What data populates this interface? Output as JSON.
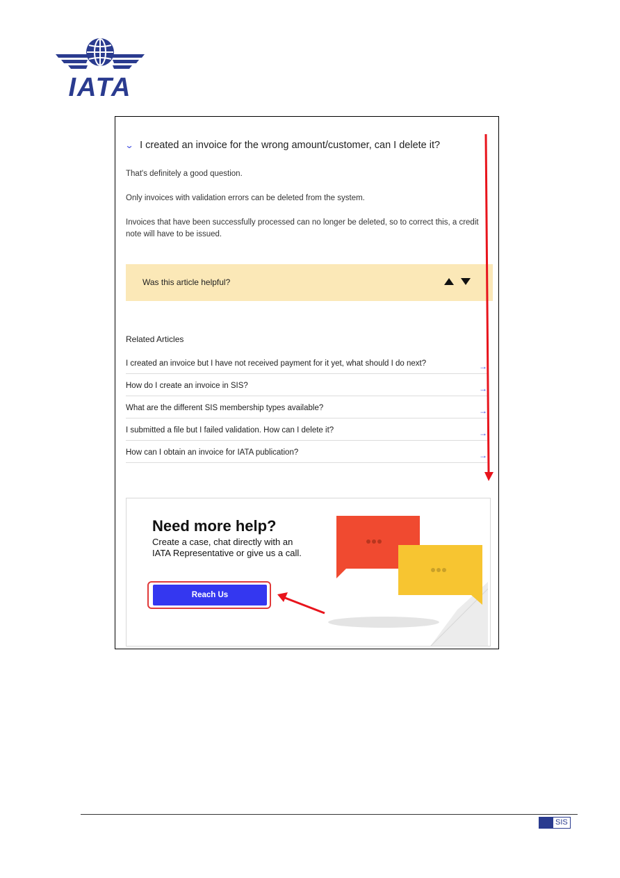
{
  "brand": {
    "logo_text": "IATA",
    "color": "#2a3b8f"
  },
  "faq": {
    "question": "I created an invoice for the wrong amount/customer, can I delete it?",
    "chevron_icon": "chevron-down-icon",
    "answer": [
      "That's definitely a good question.",
      "Only invoices with validation errors can be deleted from the system.",
      "Invoices that have been successfully processed can no longer be deleted, so to correct this, a credit note will have to be issued."
    ]
  },
  "feedback": {
    "question": "Was this article helpful?",
    "upvote_icon": "triangle-up-icon",
    "downvote_icon": "triangle-down-icon",
    "background": "#fbe8b7"
  },
  "related": {
    "title": "Related Articles",
    "items": [
      "I created an invoice but I have not received payment for it yet, what should I do next?",
      "How do I create an invoice in SIS?",
      "What are the different SIS membership types available?",
      "I submitted a file but I failed validation. How can I delete it?",
      "How can I obtain an invoice for IATA publication?"
    ],
    "arrow_glyph": "→"
  },
  "help_card": {
    "title": "Need more help?",
    "description": "Create a case, chat directly with an IATA Representative or give us a call.",
    "button_label": "Reach Us",
    "button_color": "#3437f0"
  },
  "footer": {
    "badge_text": "SIS"
  },
  "annotations": {
    "arrow_color": "#e8141c"
  }
}
